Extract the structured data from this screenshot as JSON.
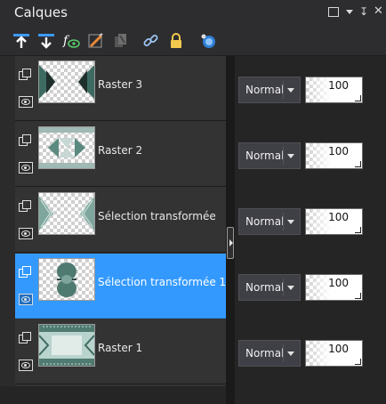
{
  "panel": {
    "title": "Calques"
  },
  "toolbar": {
    "icons": [
      "new-raster-layer-icon",
      "new-vector-layer-icon",
      "adjustment-layer-icon",
      "mask-icon",
      "duplicate-icon",
      "link-icon",
      "lock-icon",
      "layer-style-icon"
    ]
  },
  "colors": {
    "selected": "#3399ff",
    "panel": "#333333",
    "thumb_teal": "#4a7a70"
  },
  "layers": [
    {
      "name": "Raster 3",
      "blend": "Normal",
      "opacity": "100",
      "selected": false
    },
    {
      "name": "Raster 2",
      "blend": "Normal",
      "opacity": "100",
      "selected": false
    },
    {
      "name": "Sélection transformée",
      "blend": "Normal",
      "opacity": "100",
      "selected": false
    },
    {
      "name": "Sélection transformée 1",
      "blend": "Normal",
      "opacity": "100",
      "selected": true
    },
    {
      "name": "Raster 1",
      "blend": "Normal",
      "opacity": "100",
      "selected": false
    }
  ]
}
